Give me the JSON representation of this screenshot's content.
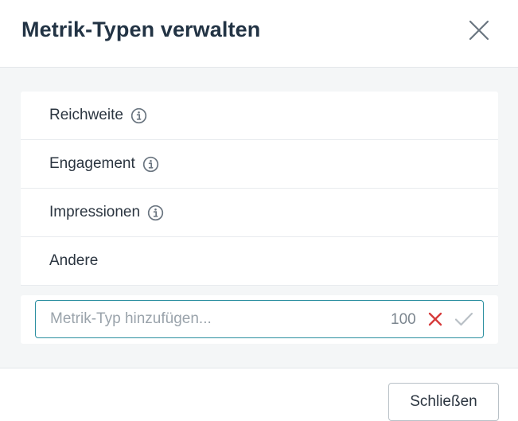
{
  "dialog": {
    "title": "Metrik-Typen verwalten",
    "close_icon": "close-icon"
  },
  "metric_types": [
    {
      "label": "Reichweite",
      "has_info": true
    },
    {
      "label": "Engagement",
      "has_info": true
    },
    {
      "label": "Impressionen",
      "has_info": true
    },
    {
      "label": "Andere",
      "has_info": false
    }
  ],
  "add_metric": {
    "placeholder": "Metrik-Typ hinzufügen...",
    "value": "",
    "char_counter": "100",
    "cancel_icon": "cancel-x-icon",
    "confirm_icon": "checkmark-icon"
  },
  "footer": {
    "close_label": "Schließen"
  },
  "colors": {
    "accent": "#2b8fa0",
    "cancel": "#d63b3b",
    "confirm_disabled": "#b9c0c6",
    "title": "#223344",
    "body_bg": "#f4f6f7"
  }
}
